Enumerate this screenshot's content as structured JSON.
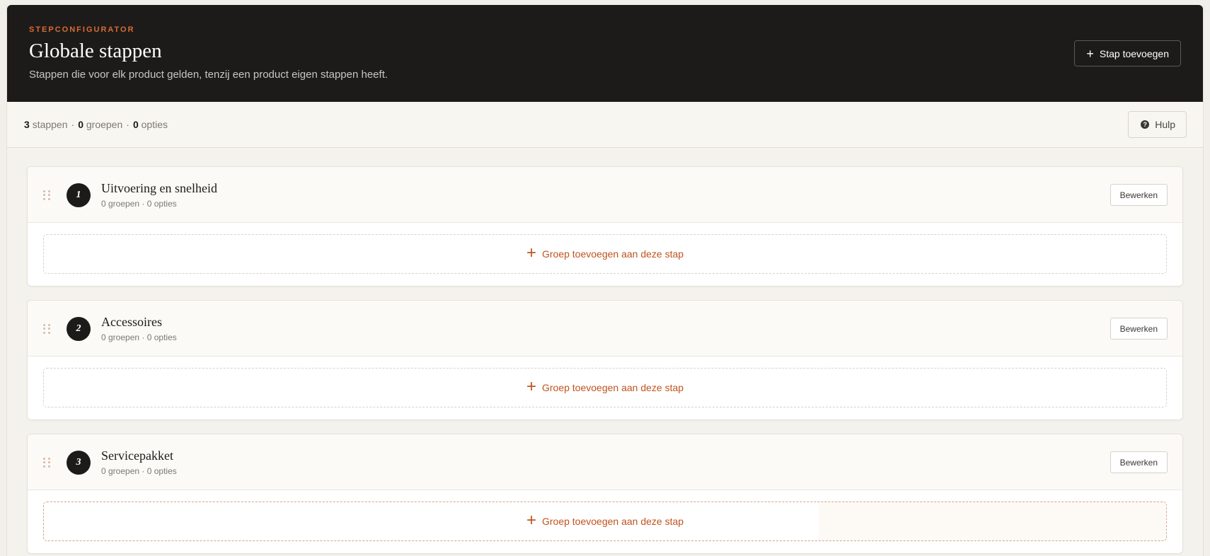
{
  "header": {
    "eyebrow": "STEPCONFIGURATOR",
    "title": "Globale stappen",
    "subtitle": "Stappen die voor elk product gelden, tenzij een product eigen stappen heeft.",
    "add_step_label": "Stap toevoegen",
    "add_step_icon": "plus-icon"
  },
  "stats": {
    "steps_count": "3",
    "steps_label": "stappen",
    "groups_count": "0",
    "groups_label": "groepen",
    "options_count": "0",
    "options_label": "opties",
    "separator": "·"
  },
  "help": {
    "label": "Hulp",
    "icon": "question-circle-icon",
    "icon_glyph": "?"
  },
  "steps": [
    {
      "number": "1",
      "title": "Uitvoering en snelheid",
      "meta": "0 groepen · 0 opties",
      "edit_label": "Bewerken",
      "add_group_label": "Groep toevoegen aan deze stap"
    },
    {
      "number": "2",
      "title": "Accessoires",
      "meta": "0 groepen · 0 opties",
      "edit_label": "Bewerken",
      "add_group_label": "Groep toevoegen aan deze stap"
    },
    {
      "number": "3",
      "title": "Servicepakket",
      "meta": "0 groepen · 0 opties",
      "edit_label": "Bewerken",
      "add_group_label": "Groep toevoegen aan deze stap"
    }
  ],
  "colors": {
    "header_bg": "#1c1b19",
    "accent": "#c0531e",
    "eyebrow": "#d96b34",
    "page_bg": "#f4f2ed"
  }
}
